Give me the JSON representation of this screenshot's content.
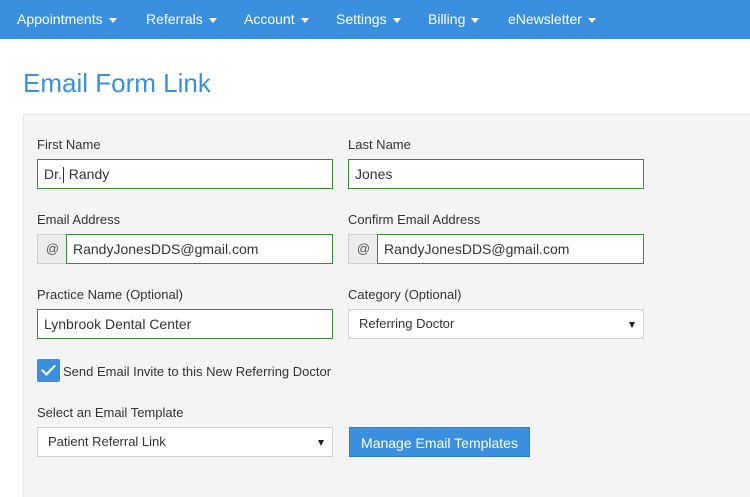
{
  "nav": {
    "items": [
      {
        "label": "Appointments"
      },
      {
        "label": "Referrals"
      },
      {
        "label": "Account"
      },
      {
        "label": "Settings"
      },
      {
        "label": "Billing"
      },
      {
        "label": "eNewsletter"
      }
    ]
  },
  "page": {
    "title": "Email Form Link"
  },
  "form": {
    "first_name": {
      "label": "First Name",
      "value_before_caret": "Dr.",
      "value_after_caret": " Randy"
    },
    "last_name": {
      "label": "Last Name",
      "value": "Jones"
    },
    "email": {
      "label": "Email Address",
      "addon": "@",
      "value": "RandyJonesDDS@gmail.com"
    },
    "confirm_email": {
      "label": "Confirm Email Address",
      "addon": "@",
      "value": "RandyJonesDDS@gmail.com"
    },
    "practice_name": {
      "label": "Practice Name (Optional)",
      "value": "Lynbrook Dental Center"
    },
    "category": {
      "label": "Category (Optional)",
      "selected": "Referring Doctor"
    },
    "send_invite": {
      "label": "Send Email Invite to this New Referring Doctor",
      "checked": true
    },
    "template": {
      "label": "Select an Email Template",
      "selected": "Patient Referral Link"
    },
    "manage_button": {
      "label": "Manage Email Templates"
    }
  },
  "colors": {
    "accent": "#3a8fde",
    "valid_border": "#3c8a3c",
    "panel_bg": "#f4f4f4"
  }
}
